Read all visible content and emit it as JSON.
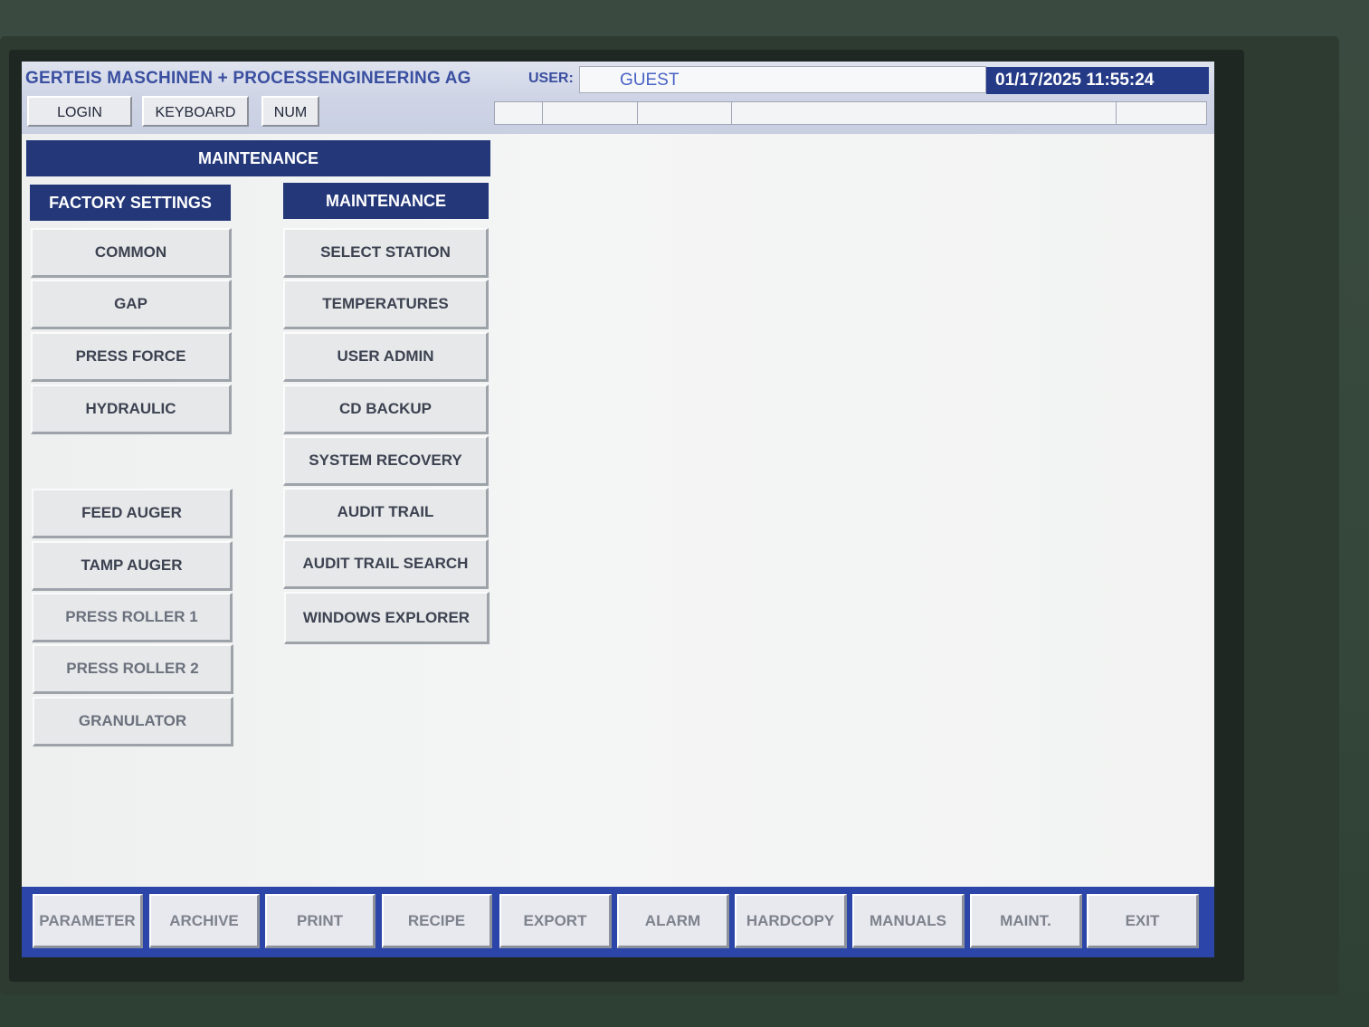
{
  "header": {
    "company": "GERTEIS MASCHINEN + PROCESSENGINEERING AG",
    "user_label": "USER:",
    "user_value": "GUEST",
    "datetime": "01/17/2025  11:55:24"
  },
  "toolbar": {
    "login": "LOGIN",
    "keyboard": "KEYBOARD",
    "num": "NUM"
  },
  "page": {
    "title": "MAINTENANCE"
  },
  "factory_settings": {
    "header": "FACTORY SETTINGS",
    "items": [
      "COMMON",
      "GAP",
      "PRESS FORCE",
      "HYDRAULIC",
      "FEED AUGER",
      "TAMP AUGER",
      "PRESS ROLLER 1",
      "PRESS ROLLER 2",
      "GRANULATOR"
    ]
  },
  "maintenance": {
    "header": "MAINTENANCE",
    "items": [
      "SELECT STATION",
      "TEMPERATURES",
      "USER ADMIN",
      "CD BACKUP",
      "SYSTEM  RECOVERY",
      "AUDIT TRAIL",
      "AUDIT TRAIL  SEARCH",
      "WINDOWS EXPLORER"
    ]
  },
  "bottom_nav": {
    "items": [
      "PARAMETER",
      "ARCHIVE",
      "PRINT",
      "RECIPE",
      "EXPORT",
      "ALARM",
      "HARDCOPY",
      "MANUALS",
      "MAINT.",
      "EXIT"
    ]
  },
  "colors": {
    "header_blue": "#233779",
    "bottom_bar_blue": "#2b46a8",
    "title_text_blue": "#3a4fa0"
  },
  "icons": {
    "cursor": "mouse-pointer-icon"
  }
}
